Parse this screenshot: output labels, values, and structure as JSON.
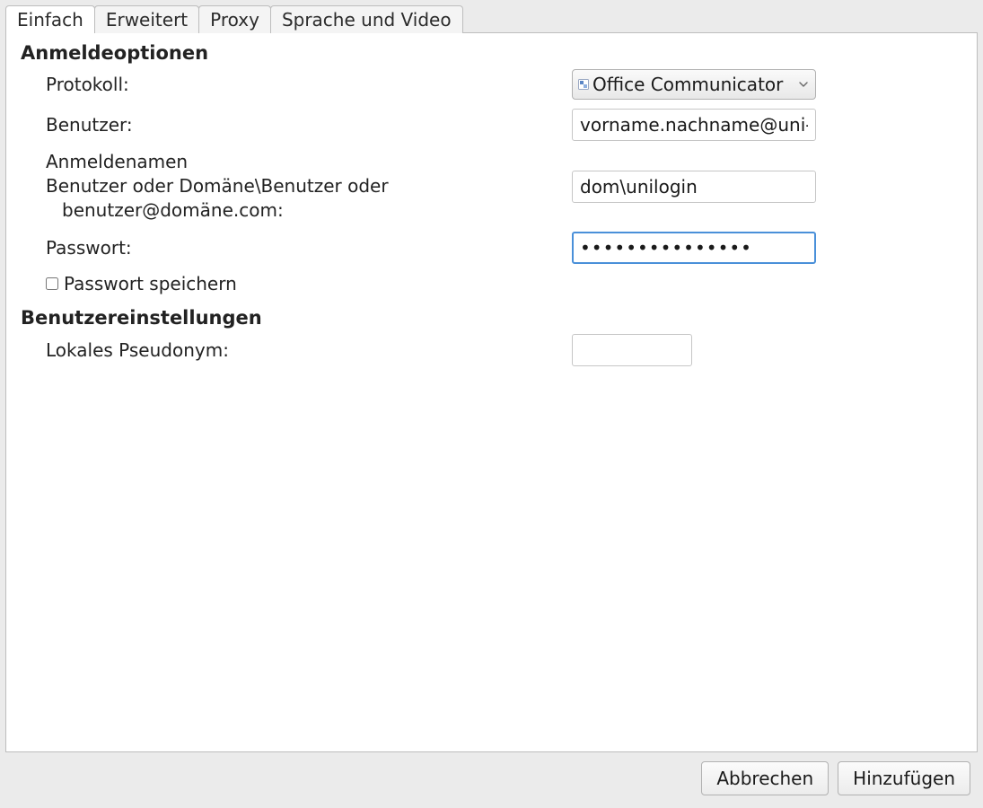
{
  "tabs": {
    "simple": "Einfach",
    "advanced": "Erweitert",
    "proxy": "Proxy",
    "language_video": "Sprache und Video"
  },
  "sections": {
    "login_options": "Anmeldeoptionen",
    "user_settings": "Benutzereinstellungen"
  },
  "labels": {
    "protocol": "Protokoll:",
    "user": "Benutzer:",
    "login_name_line1": "Anmeldenamen",
    "login_name_line2": "Benutzer oder Domäne\\Benutzer oder",
    "login_name_line3": "benutzer@domäne.com:",
    "password": "Passwort:",
    "save_password": "Passwort speichern",
    "local_alias": "Lokales Pseudonym:"
  },
  "values": {
    "protocol_selected": "Office Communicator",
    "user": "vorname.nachname@uni-",
    "login_name": "dom\\unilogin",
    "password": "•••••••••••••••",
    "save_password_checked": false,
    "local_alias": ""
  },
  "buttons": {
    "cancel": "Abbrechen",
    "add": "Hinzufügen"
  }
}
